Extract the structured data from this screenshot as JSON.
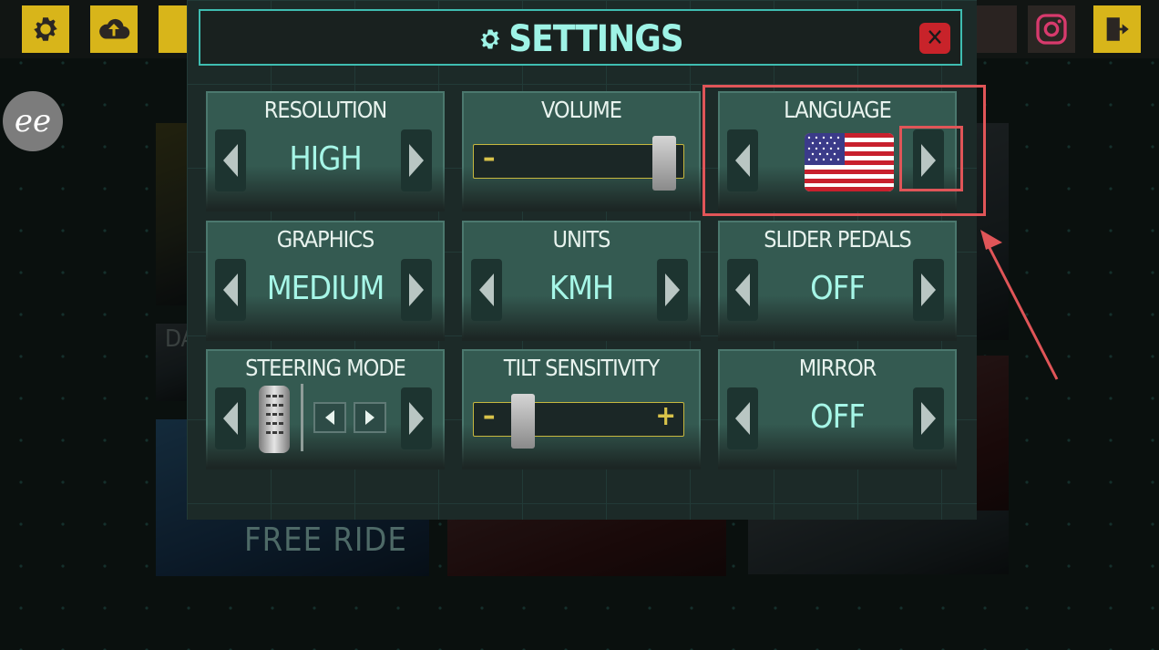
{
  "modal": {
    "title": "SETTINGS",
    "close_icon": "close-icon"
  },
  "tiles": {
    "resolution": {
      "label": "RESOLUTION",
      "value": "HIGH"
    },
    "volume": {
      "label": "VOLUME",
      "minus": "–",
      "plus": "+",
      "level": 0.95
    },
    "language": {
      "label": "LANGUAGE",
      "flag": "us-flag"
    },
    "graphics": {
      "label": "GRAPHICS",
      "value": "MEDIUM"
    },
    "units": {
      "label": "UNITS",
      "value": "KMH"
    },
    "slider_pedals": {
      "label": "SLIDER PEDALS",
      "value": "OFF"
    },
    "steering_mode": {
      "label": "STEERING MODE",
      "icon": "pedal-icon"
    },
    "tilt_sensitivity": {
      "label": "TILT SENSITIVITY",
      "minus": "–",
      "plus": "+",
      "level": 0.2
    },
    "mirror": {
      "label": "MIRROR",
      "value": "OFF"
    }
  },
  "background": {
    "mode_free_ride": "FREE RIDE",
    "da_label": "DA",
    "ee_logo": "ee"
  },
  "colors": {
    "accent": "#a6f6e7",
    "tile": "#345a51",
    "close": "#c8232a",
    "highlight": "#e05558"
  }
}
